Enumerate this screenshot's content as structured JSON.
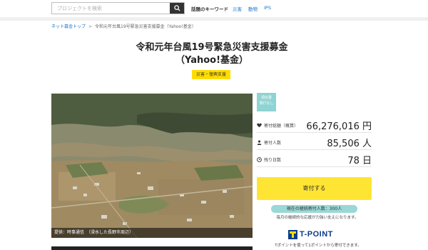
{
  "header": {
    "search_placeholder": "プロジェクトを検索",
    "keyword_title": "話題のキーワード",
    "keywords": [
      "災害",
      "動物",
      "IPS"
    ]
  },
  "breadcrumb": {
    "home": "ネット募金トップ",
    "separator": ">",
    "current": "令和元年台風19号緊急災害支援募金（Yahoo!基金）"
  },
  "project": {
    "title_line1": "令和元年台風19号緊急災害支援募金",
    "title_line2": "（Yahoo!基金）",
    "tag": "災害・復興支援",
    "photo_caption": "提供：時事通信　（浸水した長野市周辺）"
  },
  "sidebar": {
    "badge_line1": "領収書",
    "badge_line2": "発行なし",
    "stats": [
      {
        "icon": "heart-icon",
        "label": "寄付総額（概算）",
        "value": "66,276,016 円"
      },
      {
        "icon": "person-icon",
        "label": "寄付人数",
        "value": "85,506 人"
      },
      {
        "icon": "clock-icon",
        "label": "残り日数",
        "value": "78 日"
      }
    ],
    "donate_label": "寄付する",
    "supporters": "現在の継続寄付人数：300人",
    "supporters_note": "毎月の継続的な応援が力強い支えになります。",
    "tpoint_label": "T-POINT",
    "tpoint_note": "Tポイントを使って1ポイントから寄付できます。"
  },
  "colors": {
    "accent_yellow": "#ffe533",
    "badge_teal": "#8fd3d2",
    "link_blue": "#1a73c7"
  }
}
